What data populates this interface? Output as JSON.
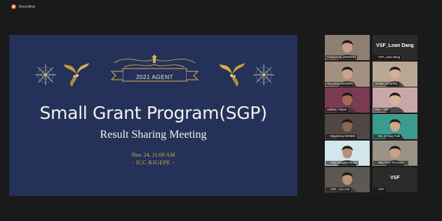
{
  "recording": {
    "label": "Recording"
  },
  "slide": {
    "banner": "2021 AGENT",
    "title": "Small Grant Program(SGP)",
    "subtitle": "Result Sharing Meeting",
    "date": "Nov. 24, 11:00 AM",
    "venue": "- ICC KIGEPE -"
  },
  "participants": [
    {
      "name": "Chaeyoung (KIGEPE)",
      "muted": false,
      "video": true,
      "bg": "#8e7f73",
      "face": "#c79f86"
    },
    {
      "name": "VSF_Loan Dang",
      "display": "VSF_Loan Dang",
      "muted": true,
      "video": false
    },
    {
      "name": "Ha young (KIGEPE)",
      "muted": false,
      "video": true,
      "bg": "#a49080",
      "face": "#caa48c"
    },
    {
      "name": "Heallet (KIGEPE)",
      "muted": false,
      "video": true,
      "bg": "#b9a891",
      "face": "#d2b096"
    },
    {
      "name": "Sabitra / Nepal",
      "muted": false,
      "video": true,
      "bg": "#7a3a52",
      "face": "#a46b53"
    },
    {
      "name": "Diep - VSF",
      "muted": false,
      "video": true,
      "active": true,
      "bg": "#c9a7a6",
      "face": "#d9b29b"
    },
    {
      "name": "Bayarmaa MONES",
      "muted": true,
      "video": true,
      "bg": "#504743",
      "face": "#8c6650"
    },
    {
      "name": "Min Ji Yang Park",
      "muted": true,
      "video": true,
      "bg": "#3b9c8d",
      "face": "#cfa58c"
    },
    {
      "name": "Arby Dangsyi Utomo",
      "muted": true,
      "video": true,
      "bg": "#d2e6ec",
      "face": "#b89078"
    },
    {
      "name": "NGUYEN THI LINH ...",
      "muted": true,
      "video": true,
      "bg": "#9a9486",
      "face": "#c9a187"
    },
    {
      "name": "VSF - Lan Anh",
      "muted": true,
      "video": true,
      "bg": "#5c5852",
      "face": "#b89377"
    },
    {
      "name": "VSF",
      "display": "VSF",
      "muted": true,
      "video": false
    }
  ],
  "colors": {
    "slide_bg": "#243259",
    "gold": "#d8b04f",
    "active_border": "#c8e86a",
    "mic_off": "#e0413a"
  }
}
